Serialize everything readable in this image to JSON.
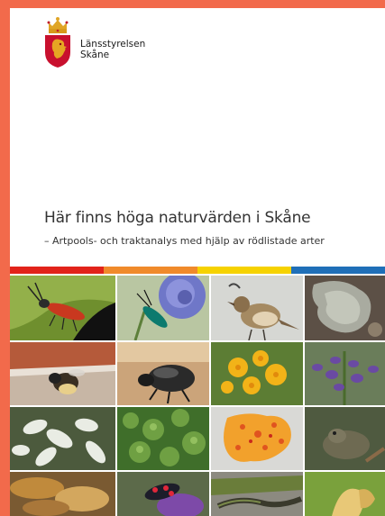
{
  "logo": {
    "line1": "Länsstyrelsen",
    "line2": "Skåne",
    "icon": "coat-of-arms-icon"
  },
  "title": "Här finns höga naturvärden i Skåne",
  "subtitle": "– Artpools- och traktanalys med hjälp av rödlistade arter",
  "colors": {
    "border": "#f26a4b",
    "bars": [
      "#e2231a",
      "#f08a2b",
      "#f6d200",
      "#1f6fb8"
    ]
  }
}
